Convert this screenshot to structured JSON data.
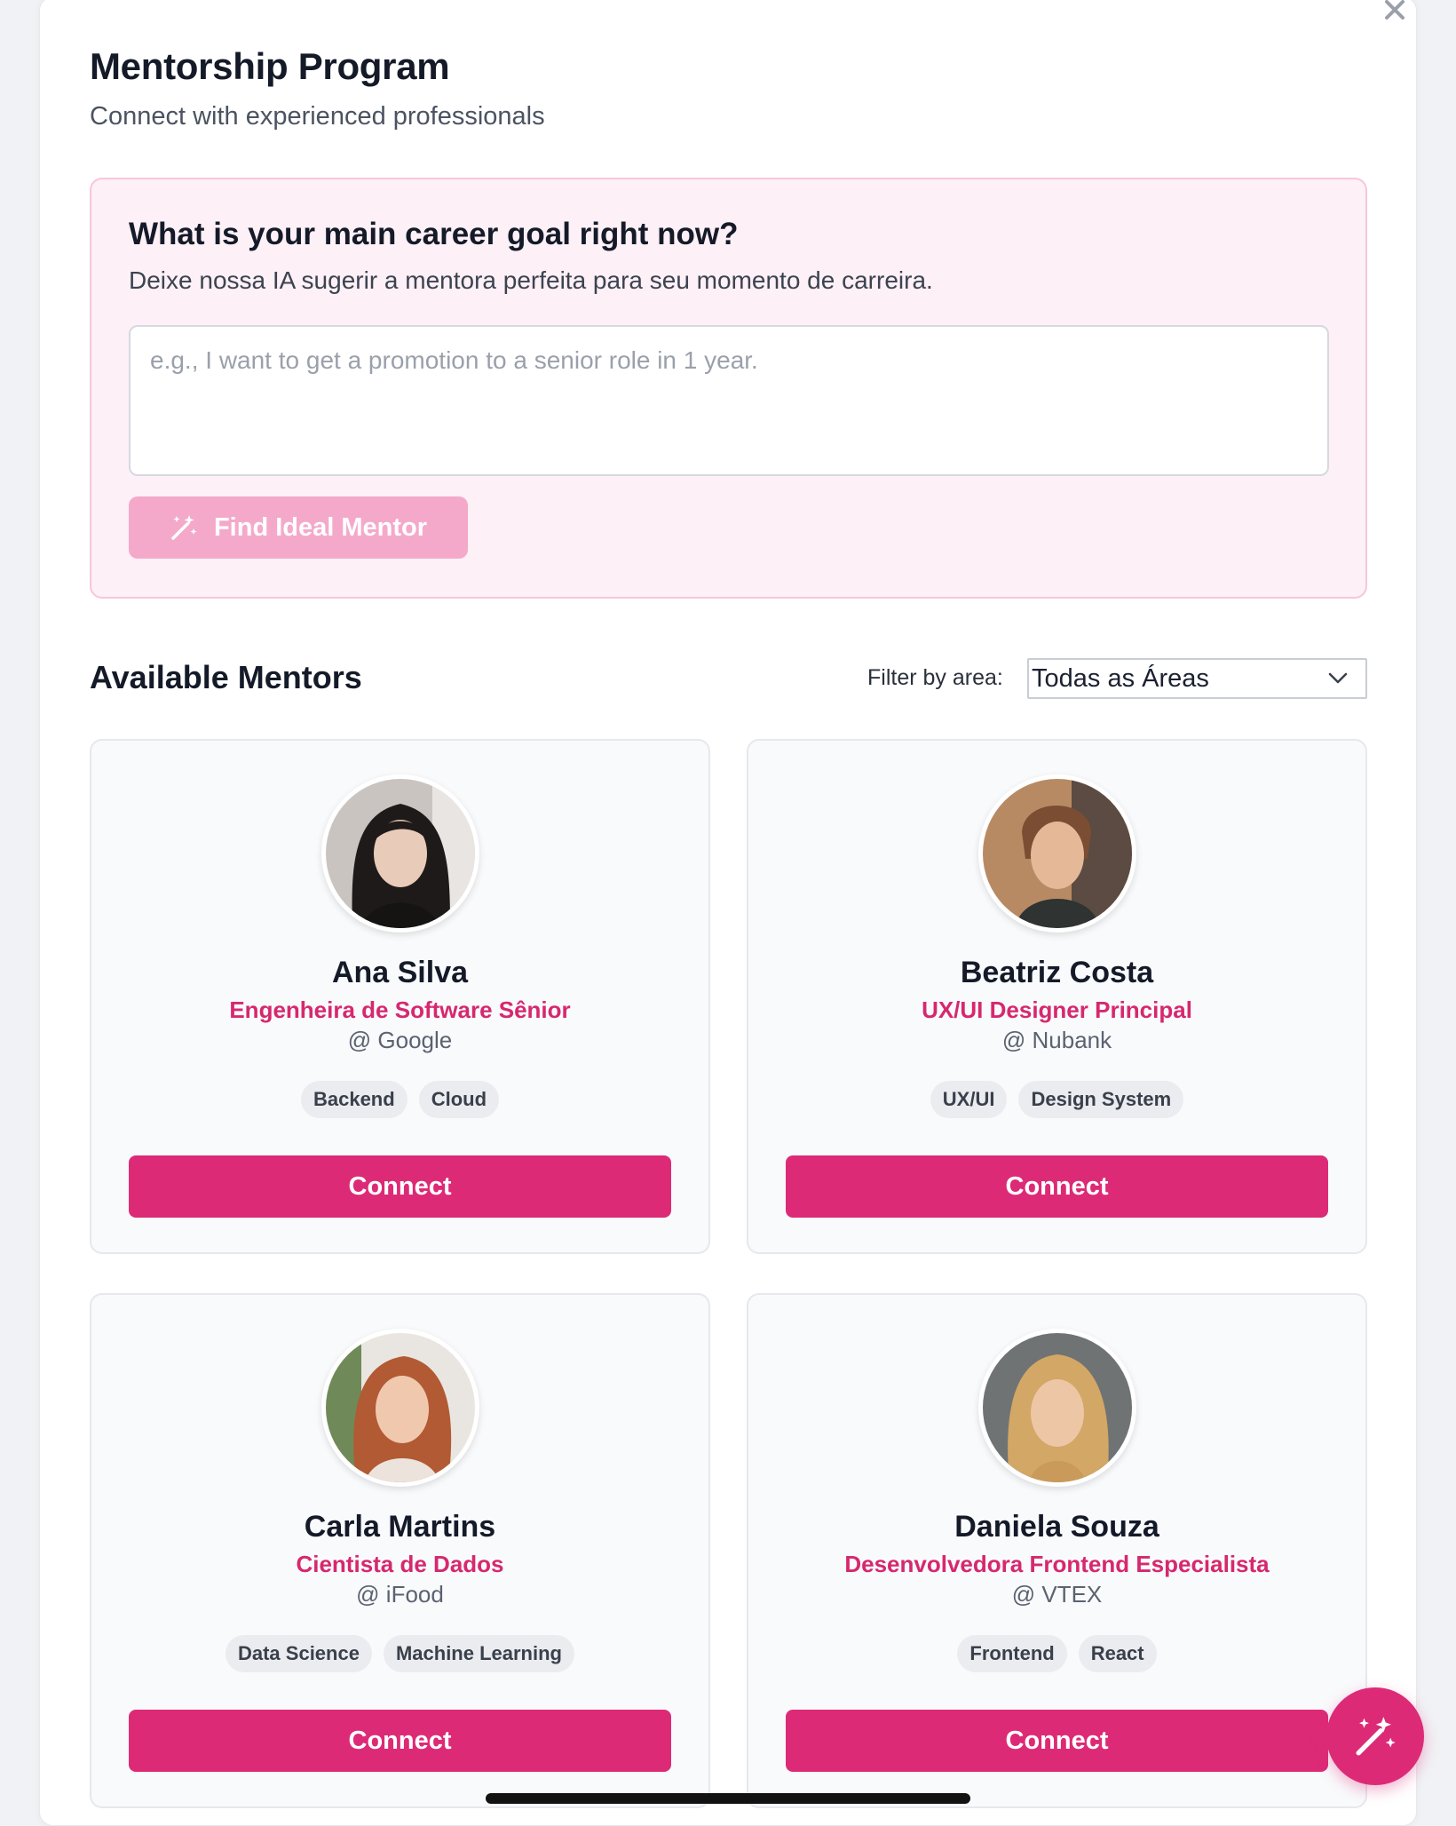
{
  "header": {
    "title": "Mentorship Program",
    "subtitle": "Connect with experienced professionals",
    "close_icon": "close-icon"
  },
  "goal": {
    "title": "What is your main career goal right now?",
    "subtitle": "Deixe nossa IA sugerir a mentora perfeita para seu momento de carreira.",
    "input_placeholder": "e.g., I want to get a promotion to a senior role in 1 year.",
    "input_value": "",
    "button_label": "Find Ideal Mentor",
    "button_icon": "magic-wand-icon"
  },
  "mentors_section": {
    "title": "Available Mentors",
    "filter_label": "Filter by area:",
    "filter_selected": "Todas as Áreas"
  },
  "mentors": [
    {
      "name": "Ana Silva",
      "role": "Engenheira de Software Sênior",
      "company": "@ Google",
      "tags": [
        "Backend",
        "Cloud"
      ],
      "connect_label": "Connect"
    },
    {
      "name": "Beatriz Costa",
      "role": "UX/UI Designer Principal",
      "company": "@ Nubank",
      "tags": [
        "UX/UI",
        "Design System"
      ],
      "connect_label": "Connect"
    },
    {
      "name": "Carla Martins",
      "role": "Cientista de Dados",
      "company": "@ iFood",
      "tags": [
        "Data Science",
        "Machine Learning"
      ],
      "connect_label": "Connect"
    },
    {
      "name": "Daniela Souza",
      "role": "Desenvolvedora Frontend Especialista",
      "company": "@ VTEX",
      "tags": [
        "Frontend",
        "React"
      ],
      "connect_label": "Connect"
    }
  ],
  "fab": {
    "icon": "magic-wand-icon"
  },
  "colors": {
    "accent": "#dd2a77",
    "accent_light": "#f4a9cb",
    "panel_bg": "#fdf0f6",
    "panel_border": "#f7c6dc"
  }
}
